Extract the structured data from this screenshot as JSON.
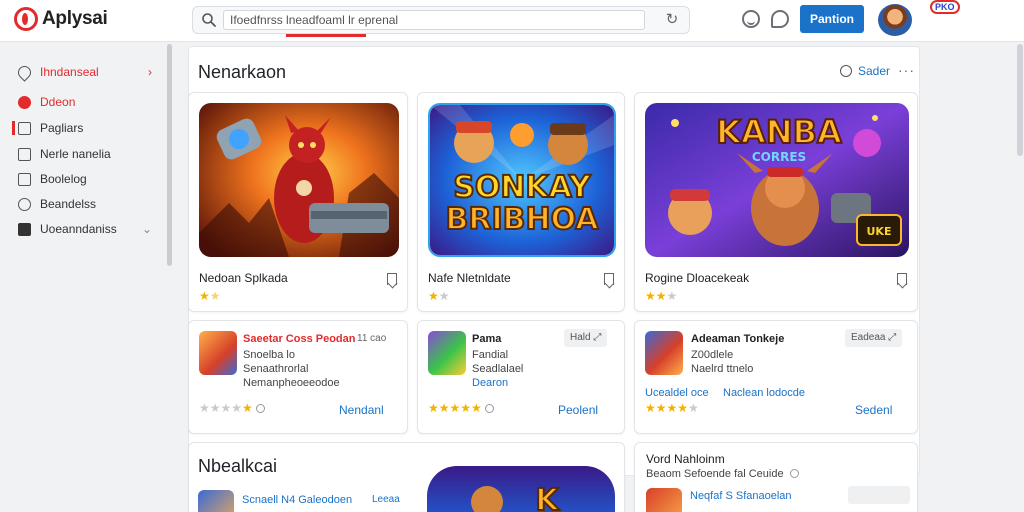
{
  "app": {
    "name": "Aplysai"
  },
  "search": {
    "value": "Ifoedfnrss lneadfoaml lr eprenal"
  },
  "header": {
    "primary_button": "Pantion",
    "badge": "PKO"
  },
  "sidebar": {
    "items": [
      {
        "label": "Ihndanseal",
        "icon": "heart-icon",
        "style": "red",
        "chevron": "›"
      },
      {
        "label": "Ddeon",
        "icon": "play-icon",
        "style": "red"
      },
      {
        "label": "Pagliars",
        "icon": "grid-icon"
      },
      {
        "label": "Nerle nanelia",
        "icon": "list-icon"
      },
      {
        "label": "Boolelog",
        "icon": "checkbox-icon"
      },
      {
        "label": "Beandelss",
        "icon": "gear-icon"
      },
      {
        "label": "Uoeanndaniss",
        "icon": "info-icon",
        "chevron": "⌄"
      }
    ]
  },
  "main": {
    "section1": {
      "title": "Nenarkaon",
      "see_more": "Sader",
      "more": "···"
    },
    "featured": [
      {
        "title": "Nedoan Splkada",
        "rating": 1.5
      },
      {
        "title": "Nafe Nletnldate",
        "rating": 1.5,
        "art_text": [
          "SONKAY",
          "BRIBHOA"
        ]
      },
      {
        "title": "Rogine Dloacekeak",
        "rating": 2,
        "art_text": [
          "KANBA",
          "CORRES"
        ]
      }
    ],
    "list": [
      {
        "title": "Saeetar Coss Peodan",
        "sub1": "Snoelba lo",
        "sub2": "Senaathrorlal",
        "sub3": "Nemanpheoeeodoe",
        "tag": "11 cao",
        "link": "Nendanl",
        "rating": 0
      },
      {
        "title": "Pama",
        "sub1": "Fandial",
        "sub2": "Seadlalael",
        "sub3": "Dearon",
        "tag": "Hald",
        "link": "Peolenl",
        "rating": 5
      },
      {
        "title": "Adeaman Tonkeje",
        "sub1": "Z00dlele",
        "sub2": "Naelrd ttnelo",
        "sub3": "Ucealdel oce",
        "sub3b": "Naclean lodocde",
        "tag": "Eadeaa",
        "link": "Sedenl",
        "rating": 4
      }
    ],
    "section2": {
      "title": "Nbealkcai"
    },
    "list2": [
      {
        "title": "Scnaell N4 Galeodoen",
        "tag": "Leeaa"
      }
    ],
    "side_detail": {
      "title": "Vord Nahloinm",
      "sub": "Beaom Sefoende fal Ceuide",
      "item_title": "Neqfaf S Sfanaoelan"
    }
  }
}
